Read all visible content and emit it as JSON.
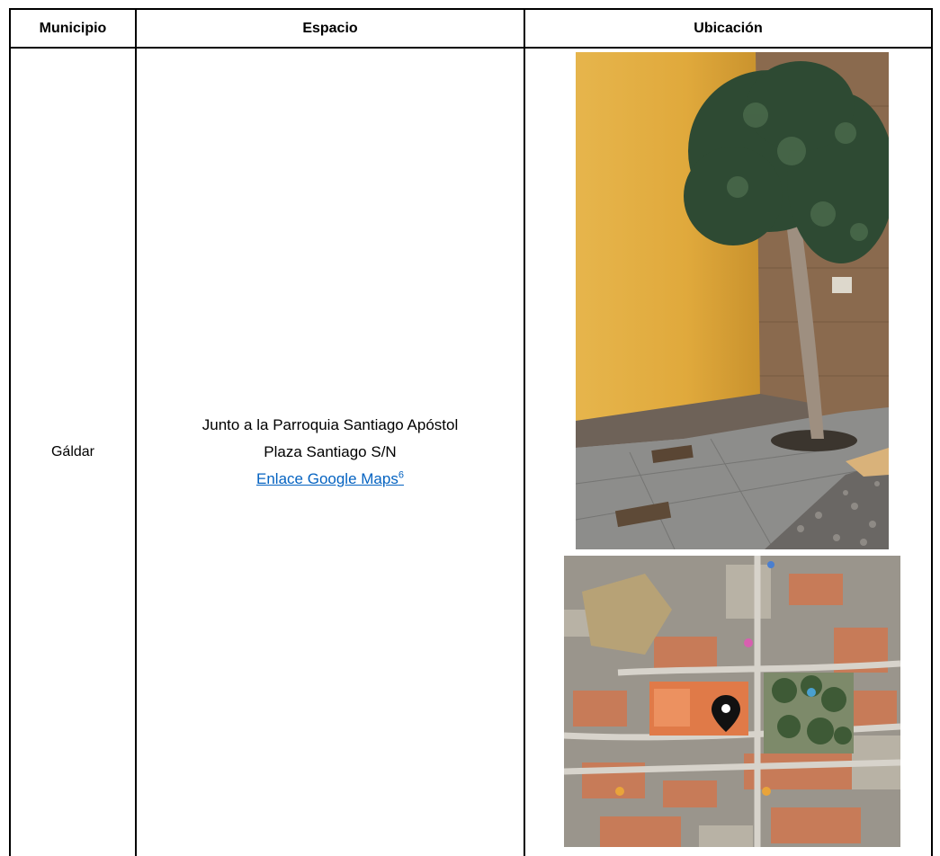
{
  "table": {
    "headers": [
      "Municipio",
      "Espacio",
      "Ubicación"
    ],
    "row": {
      "municipio": "Gáldar",
      "espacio_line1": "Junto a la Parroquia Santiago Apóstol",
      "espacio_line2": "Plaza Santiago S/N",
      "link_text": "Enlace Google Maps",
      "footnote": "6"
    }
  },
  "images": {
    "photo_icon": "street-photo",
    "map_icon": "satellite-map",
    "map_marker_icon": "location-pin-icon"
  }
}
